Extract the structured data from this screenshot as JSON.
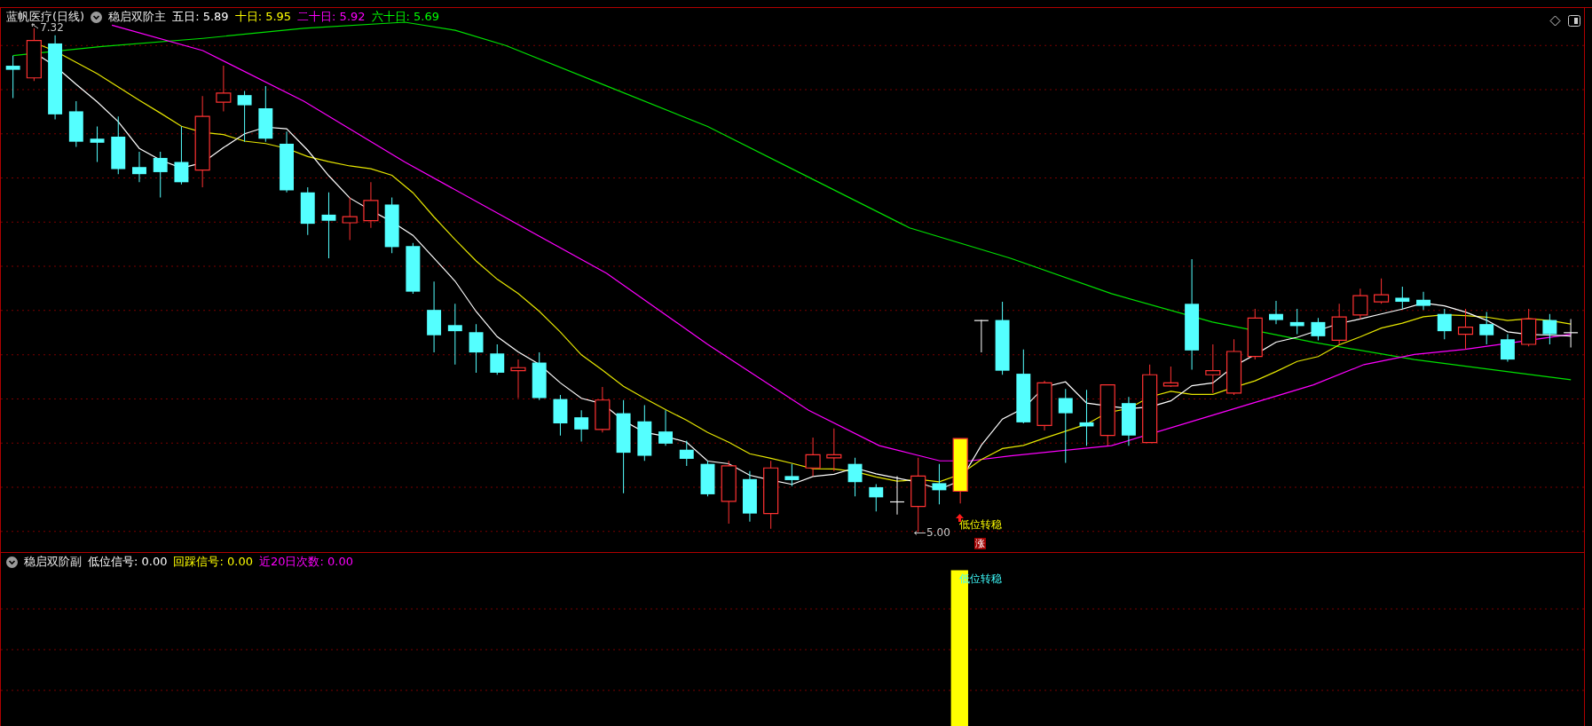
{
  "main_panel": {
    "stock_title": "蓝帆医疗(日线)",
    "indicator_name": "稳启双阶主",
    "legend": [
      {
        "label": "五日: 5.89",
        "color": "#ffffff"
      },
      {
        "label": "十日: 5.95",
        "color": "#ffff00"
      },
      {
        "label": "二十日: 5.92",
        "color": "#ff00ff"
      },
      {
        "label": "六十日: 5.69",
        "color": "#00ff00"
      }
    ],
    "high_label": "7.32",
    "low_label": "5.00",
    "signal_label": "低位转稳",
    "rise_badge": "涨"
  },
  "sub_panel": {
    "indicator_name": "稳启双阶副",
    "legend": [
      {
        "label": "低位信号: 0.00",
        "color": "#ffffff"
      },
      {
        "label": "回踩信号: 0.00",
        "color": "#ffff00"
      },
      {
        "label": "近20日次数: 0.00",
        "color": "#ff00ff"
      }
    ],
    "signal_label": "低位转稳"
  }
}
